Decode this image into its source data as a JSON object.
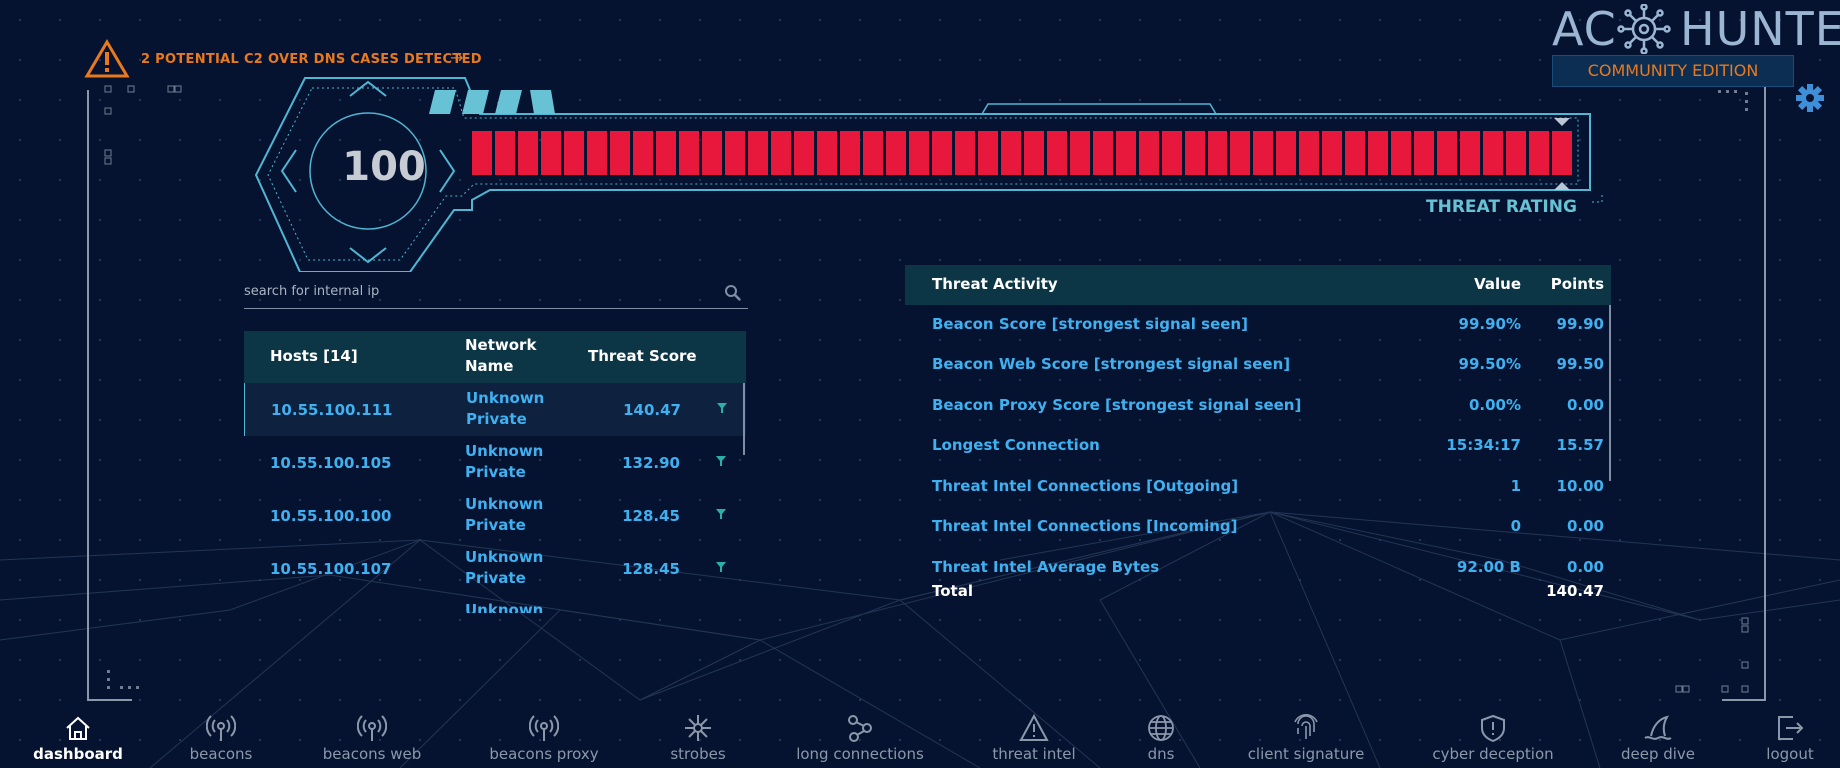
{
  "alert": {
    "text": "2 POTENTIAL C2 OVER DNS CASES DETECTED",
    "arrow": "→"
  },
  "brand": {
    "name_left": "AC",
    "name_right": "HUNTER",
    "edition": "COMMUNITY EDITION",
    "logo_icon": "virus-logo-icon"
  },
  "threat_rating": {
    "score": "100",
    "label": "THREAT RATING",
    "level_percent": 100,
    "bar_color": "#e8173c"
  },
  "search": {
    "placeholder": "search for internal ip"
  },
  "hosts": {
    "headers": {
      "host": "Hosts [14]",
      "network_line1": "Network",
      "network_line2": "Name",
      "score": "Threat Score"
    },
    "rows": [
      {
        "ip": "10.55.100.111",
        "net1": "Unknown",
        "net2": "Private",
        "score": "140.47",
        "selected": true
      },
      {
        "ip": "10.55.100.105",
        "net1": "Unknown",
        "net2": "Private",
        "score": "132.90"
      },
      {
        "ip": "10.55.100.100",
        "net1": "Unknown",
        "net2": "Private",
        "score": "128.45"
      },
      {
        "ip": "10.55.100.107",
        "net1": "Unknown",
        "net2": "Private",
        "score": "128.45"
      },
      {
        "ip": "",
        "net1": "Unknown",
        "net2": "",
        "score": ""
      }
    ]
  },
  "activity": {
    "headers": {
      "activity": "Threat Activity",
      "value": "Value",
      "points": "Points"
    },
    "rows": [
      {
        "label": "Beacon Score [strongest signal seen]",
        "value": "99.90%",
        "points": "99.90"
      },
      {
        "label": "Beacon Web Score [strongest signal seen]",
        "value": "99.50%",
        "points": "99.50"
      },
      {
        "label": "Beacon Proxy Score [strongest signal seen]",
        "value": "0.00%",
        "points": "0.00"
      },
      {
        "label": "Longest Connection",
        "value": "15:34:17",
        "points": "15.57"
      },
      {
        "label": "Threat Intel Connections [Outgoing]",
        "value": "1",
        "points": "10.00"
      },
      {
        "label": "Threat Intel Connections [Incoming]",
        "value": "0",
        "points": "0.00"
      },
      {
        "label": "Threat Intel Average Bytes",
        "value": "92.00 B",
        "points": "0.00"
      }
    ],
    "total_label": "Total",
    "total_value": "140.47"
  },
  "nav": [
    {
      "label": "dashboard",
      "icon": "home-icon",
      "active": true
    },
    {
      "label": "beacons",
      "icon": "broadcast-icon"
    },
    {
      "label": "beacons web",
      "icon": "broadcast-icon"
    },
    {
      "label": "beacons proxy",
      "icon": "broadcast-icon"
    },
    {
      "label": "strobes",
      "icon": "starburst-icon"
    },
    {
      "label": "long connections",
      "icon": "nodes-icon"
    },
    {
      "label": "threat intel",
      "icon": "warning-icon"
    },
    {
      "label": "dns",
      "icon": "globe-icon"
    },
    {
      "label": "client signature",
      "icon": "fingerprint-icon"
    },
    {
      "label": "cyber deception",
      "icon": "shield-icon"
    },
    {
      "label": "deep dive",
      "icon": "shark-fin-icon"
    },
    {
      "label": "logout",
      "icon": "logout-icon"
    }
  ]
}
